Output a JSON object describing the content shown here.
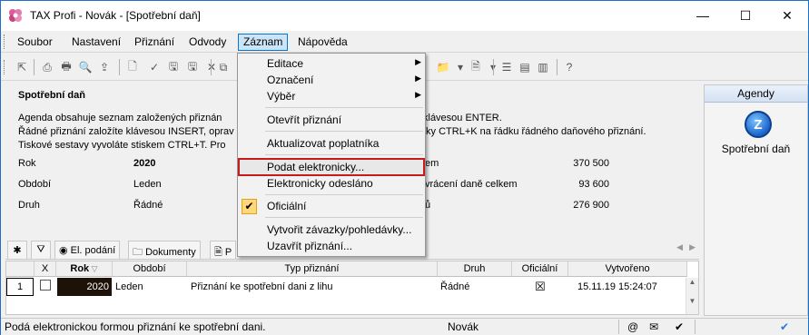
{
  "window": {
    "title": "TAX Profi - Novák - [Spotřební daň]",
    "min": "—",
    "max": "☐",
    "close": "✕"
  },
  "menubar": [
    "Soubor",
    "Nastavení",
    "Přiznání",
    "Odvody",
    "Záznam",
    "Nápověda"
  ],
  "dropdown": {
    "items": [
      {
        "label": "Editace",
        "submenu": true
      },
      {
        "label": "Označení",
        "submenu": true
      },
      {
        "label": "Výběr",
        "submenu": true
      },
      {
        "label": "Otevřít přiznání"
      },
      {
        "label": "Aktualizovat poplatníka"
      },
      {
        "label": "Podat elektronicky...",
        "highlighted": true
      },
      {
        "label": "Elektronicky odesláno"
      },
      {
        "label": "Oficiální",
        "checked": true
      },
      {
        "label": "Vytvořit závazky/pohledávky..."
      },
      {
        "label": "Uzavřít přiznání..."
      }
    ],
    "check_glyph": "✔",
    "arrow_glyph": "▶"
  },
  "info": {
    "title": "Spotřební daň",
    "desc": [
      "Agenda obsahuje seznam založených přiznán",
      "Řádné přiznání založíte klávesou INSERT, oprav",
      "Tiskové sestavy vyvoláte stiskem CTRL+T. Pro"
    ],
    "desc_right": [
      "klávesou ENTER.",
      "tky CTRL+K na řádku řádného daňového přiznání.",
      ""
    ],
    "fields": [
      {
        "label": "Rok",
        "value": "2020"
      },
      {
        "label": "Období",
        "value": "Leden"
      },
      {
        "label": "Druh",
        "value": "Řádné"
      }
    ],
    "right_fields": [
      {
        "label": "em",
        "value": "370 500"
      },
      {
        "label": "vrácení daně celkem",
        "value": "93 600"
      },
      {
        "label": "ů",
        "value": "276 900"
      }
    ]
  },
  "agenda": {
    "header": "Agendy",
    "label": "Spotřební daň"
  },
  "tabs": [
    "El. podání",
    "Dokumenty",
    "P"
  ],
  "grid": {
    "columns": [
      "X",
      "Rok",
      "Období",
      "Typ přiznání",
      "Druh",
      "Oficiální",
      "Vytvořeno"
    ],
    "rows": [
      {
        "num": "1",
        "x": "",
        "rok": "2020",
        "obdobi": "Leden",
        "typ": "Přiznání ke spotřební dani z lihu",
        "druh": "Řádné",
        "oficialni": "☒",
        "vytvoreno": "15.11.19 15:24:07"
      }
    ]
  },
  "statusbar": {
    "message": "Podá elektronickou formou přiznání ke spotřební dani.",
    "user": "Novák",
    "at": "@"
  }
}
